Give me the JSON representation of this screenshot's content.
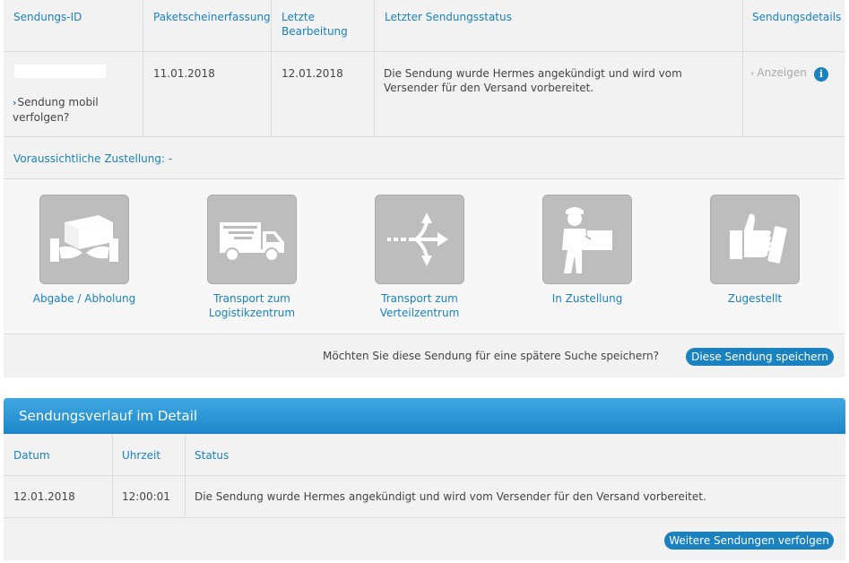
{
  "summary_table": {
    "headers": {
      "id": "Sendungs-ID",
      "capture": "Paketscheinerfassung",
      "last_edit": "Letzte Bearbeitung",
      "last_status": "Letzter Sendungsstatus",
      "details": "Sendungsdetails"
    },
    "row": {
      "mobile_link": "Sendung mobil verfolgen?",
      "capture_date": "11.01.2018",
      "last_edit_date": "12.01.2018",
      "status": "Die Sendung wurde Hermes angekündigt und wird vom Versender für den Versand vorbereitet.",
      "details_link": "Anzeigen"
    }
  },
  "delivery": {
    "label": "Voraussichtliche Zustellung:",
    "value": "-"
  },
  "steps": [
    {
      "label": "Abgabe / Abholung",
      "icon": "handover-icon"
    },
    {
      "label": "Transport zum Logistikzentrum",
      "icon": "truck-icon"
    },
    {
      "label": "Transport zum Verteilzentrum",
      "icon": "distribution-arrows-icon"
    },
    {
      "label": "In Zustellung",
      "icon": "courier-icon"
    },
    {
      "label": "Zugestellt",
      "icon": "thumbs-up-icon"
    }
  ],
  "save": {
    "question": "Möchten Sie diese Sendung für eine spätere Suche speichern?",
    "button": "Diese Sendung speichern"
  },
  "history": {
    "title": "Sendungsverlauf im Detail",
    "headers": {
      "date": "Datum",
      "time": "Uhrzeit",
      "status": "Status"
    },
    "rows": [
      {
        "date": "12.01.2018",
        "time": "12:00:01",
        "status": "Die Sendung wurde Hermes angekündigt und wird vom Versender für den Versand vorbereitet."
      }
    ],
    "more_button": "Weitere Sendungen verfolgen"
  },
  "colors": {
    "accent": "#1a82c0",
    "tile": "#bdbdbd",
    "panel_head": "#2b97d6"
  }
}
